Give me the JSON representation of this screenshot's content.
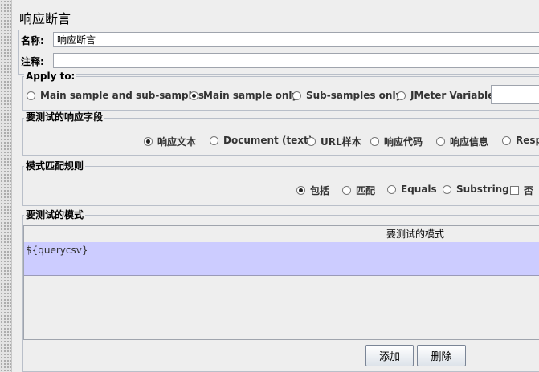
{
  "title": "响应断言",
  "name_label": "名称:",
  "name_value": "响应断言",
  "comment_label": "注释:",
  "comment_value": "",
  "apply_to": {
    "title": "Apply to:",
    "options": [
      "Main sample and sub-samples",
      "Main sample only",
      "Sub-samples only",
      "JMeter Variable"
    ],
    "selected": "Main sample only",
    "variable_value": ""
  },
  "response_field": {
    "title": "要测试的响应字段",
    "options": [
      "响应文本",
      "Document (text)",
      "URL样本",
      "响应代码",
      "响应信息",
      "Resp"
    ],
    "selected": "响应文本"
  },
  "pattern_rules": {
    "title": "模式匹配规则",
    "options": [
      "包括",
      "匹配",
      "Equals",
      "Substring"
    ],
    "selected": "包括",
    "not_label": "否",
    "not_checked": false
  },
  "patterns": {
    "title": "要测试的模式",
    "column_header": "要测试的模式",
    "rows": [
      "${querycsv}"
    ]
  },
  "buttons": {
    "add": "添加",
    "delete": "删除"
  }
}
